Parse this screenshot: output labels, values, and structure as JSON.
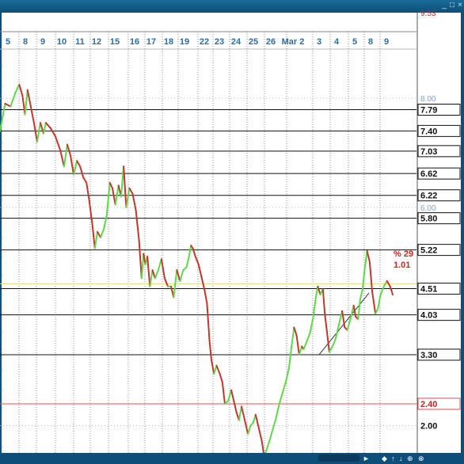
{
  "window": {
    "controls": {
      "minimize": "_",
      "maximize": "□",
      "close": "×"
    },
    "nav": {
      "right_arrow": "►",
      "first": "◆",
      "up": "↑",
      "down": "↓",
      "link": "⊕",
      "zoom": "⊗"
    }
  },
  "colors": {
    "background": "#ffffff",
    "frame": "#0d4f78",
    "date_label": "#2a6ea6",
    "up_line": "#5fd84a",
    "down_line": "#c0392b",
    "price_line": "#111111",
    "red_line": "#e05050",
    "label_blue": "#7aa4cc",
    "pct_text": "#d62020"
  },
  "chart_data": {
    "type": "line",
    "x_ticks": [
      "5",
      "8",
      "9",
      "10",
      "11",
      "12",
      "15",
      "16",
      "17",
      "18",
      "19",
      "22",
      "23",
      "24",
      "25",
      "26",
      "Mar 2",
      "3",
      "4",
      "5",
      "8",
      "9"
    ],
    "ylim": [
      1.5,
      8.9
    ],
    "grid": true,
    "top_partial_label": "9.53",
    "price_levels": [
      {
        "value": 7.79,
        "label": "7.79",
        "style": "black"
      },
      {
        "value": 7.4,
        "label": "7.40",
        "style": "black"
      },
      {
        "value": 7.03,
        "label": "7.03",
        "style": "black"
      },
      {
        "value": 6.62,
        "label": "6.62",
        "style": "black"
      },
      {
        "value": 6.22,
        "label": "6.22",
        "style": "black"
      },
      {
        "value": 5.8,
        "label": "5.80",
        "style": "black"
      },
      {
        "value": 5.22,
        "label": "5.22",
        "style": "black"
      },
      {
        "value": 4.51,
        "label": "4.51",
        "style": "black"
      },
      {
        "value": 4.03,
        "label": "4.03",
        "style": "black"
      },
      {
        "value": 3.3,
        "label": "3.30",
        "style": "black"
      },
      {
        "value": 2.4,
        "label": "2.40",
        "style": "red"
      },
      {
        "value": 2.0,
        "label": "2.00",
        "style": "plain"
      }
    ],
    "light_levels": [
      {
        "value": 8.0,
        "label": "8.00"
      },
      {
        "value": 6.0,
        "label": "6.00"
      }
    ],
    "annotations": {
      "pct": "% 29",
      "value": "1.01"
    },
    "trendline": {
      "x_start": 4.0,
      "y_start": 3.3,
      "x_end": 8.9,
      "y_end": 4.43
    },
    "series": [
      {
        "values": [
          [
            -0.38,
            7.4
          ],
          [
            -0.22,
            7.9
          ],
          [
            -0.05,
            7.85
          ],
          [
            0.1,
            8.1
          ],
          [
            0.22,
            8.25
          ],
          [
            0.32,
            8.05
          ],
          [
            0.4,
            7.7
          ],
          [
            0.48,
            8.15
          ],
          [
            0.58,
            7.85
          ],
          [
            0.68,
            7.55
          ],
          [
            0.78,
            7.2
          ],
          [
            0.88,
            7.55
          ],
          [
            0.98,
            7.35
          ],
          [
            1.05,
            7.55
          ],
          [
            1.2,
            7.45
          ],
          [
            1.35,
            7.3
          ],
          [
            1.5,
            7.05
          ],
          [
            1.62,
            6.75
          ],
          [
            1.72,
            7.15
          ],
          [
            1.82,
            6.95
          ],
          [
            1.92,
            6.6
          ],
          [
            2.02,
            6.85
          ],
          [
            2.12,
            6.75
          ],
          [
            2.22,
            6.55
          ],
          [
            2.32,
            6.45
          ],
          [
            2.4,
            6.15
          ],
          [
            2.5,
            5.7
          ],
          [
            2.58,
            5.25
          ],
          [
            2.66,
            5.55
          ],
          [
            2.76,
            5.45
          ],
          [
            2.86,
            5.6
          ],
          [
            2.95,
            5.85
          ],
          [
            3.05,
            6.45
          ],
          [
            3.13,
            6.35
          ],
          [
            3.22,
            6.05
          ],
          [
            3.32,
            6.4
          ],
          [
            3.4,
            6.2
          ],
          [
            3.48,
            6.75
          ],
          [
            3.56,
            6.0
          ],
          [
            3.66,
            6.35
          ],
          [
            3.76,
            6.25
          ],
          [
            3.86,
            5.95
          ],
          [
            3.96,
            5.4
          ],
          [
            4.04,
            4.7
          ],
          [
            4.1,
            5.15
          ],
          [
            4.16,
            4.95
          ],
          [
            4.22,
            5.1
          ],
          [
            4.3,
            4.55
          ],
          [
            4.38,
            4.85
          ],
          [
            4.46,
            4.7
          ],
          [
            4.56,
            4.85
          ],
          [
            4.66,
            5.05
          ],
          [
            4.76,
            4.7
          ],
          [
            4.86,
            4.55
          ],
          [
            4.96,
            4.55
          ],
          [
            5.04,
            4.35
          ],
          [
            5.14,
            4.85
          ],
          [
            5.24,
            4.65
          ],
          [
            5.34,
            4.85
          ],
          [
            5.44,
            4.9
          ],
          [
            5.52,
            5.1
          ],
          [
            5.58,
            5.3
          ],
          [
            5.64,
            5.25
          ],
          [
            5.72,
            5.1
          ],
          [
            5.82,
            4.95
          ],
          [
            5.92,
            4.7
          ],
          [
            6.0,
            4.5
          ],
          [
            6.08,
            4.25
          ],
          [
            6.16,
            3.55
          ],
          [
            6.22,
            3.2
          ],
          [
            6.3,
            2.95
          ],
          [
            6.38,
            3.1
          ],
          [
            6.48,
            2.95
          ],
          [
            6.56,
            2.8
          ],
          [
            6.64,
            2.4
          ],
          [
            6.74,
            2.45
          ],
          [
            6.84,
            2.65
          ],
          [
            6.92,
            2.45
          ],
          [
            7.0,
            2.25
          ],
          [
            7.08,
            2.1
          ],
          [
            7.16,
            2.35
          ],
          [
            7.26,
            2.1
          ],
          [
            7.36,
            1.85
          ],
          [
            7.44,
            2.0
          ],
          [
            7.52,
            2.05
          ],
          [
            7.6,
            2.2
          ],
          [
            7.7,
            1.95
          ],
          [
            7.8,
            1.7
          ],
          [
            7.86,
            1.45
          ],
          [
            7.94,
            1.55
          ],
          [
            8.02,
            1.7
          ],
          [
            8.12,
            1.9
          ],
          [
            8.22,
            2.1
          ],
          [
            8.34,
            2.4
          ],
          [
            8.44,
            2.6
          ],
          [
            8.54,
            2.8
          ],
          [
            8.64,
            3.05
          ],
          [
            8.72,
            3.45
          ],
          [
            8.8,
            3.8
          ],
          [
            8.88,
            3.65
          ],
          [
            8.96,
            3.3
          ],
          [
            9.04,
            3.45
          ],
          [
            9.1,
            3.4
          ],
          [
            9.2,
            3.55
          ],
          [
            9.3,
            3.7
          ],
          [
            9.4,
            4.0
          ],
          [
            9.48,
            4.35
          ],
          [
            9.54,
            4.55
          ],
          [
            9.62,
            4.4
          ],
          [
            9.7,
            4.5
          ],
          [
            9.76,
            4.05
          ],
          [
            9.82,
            3.75
          ],
          [
            9.9,
            3.35
          ],
          [
            10.0,
            3.45
          ],
          [
            10.1,
            3.6
          ],
          [
            10.2,
            3.85
          ],
          [
            10.3,
            4.1
          ],
          [
            10.38,
            3.8
          ],
          [
            10.46,
            3.75
          ],
          [
            10.56,
            3.95
          ],
          [
            10.66,
            4.2
          ],
          [
            10.72,
            4.0
          ],
          [
            10.8,
            3.95
          ],
          [
            10.86,
            4.3
          ],
          [
            10.94,
            4.5
          ],
          [
            11.0,
            4.85
          ],
          [
            11.08,
            5.2
          ],
          [
            11.16,
            5.0
          ],
          [
            11.24,
            4.45
          ],
          [
            11.34,
            4.05
          ],
          [
            11.42,
            4.15
          ],
          [
            11.5,
            4.4
          ],
          [
            11.6,
            4.55
          ],
          [
            11.7,
            4.65
          ],
          [
            11.8,
            4.55
          ],
          [
            11.88,
            4.4
          ]
        ]
      }
    ]
  }
}
